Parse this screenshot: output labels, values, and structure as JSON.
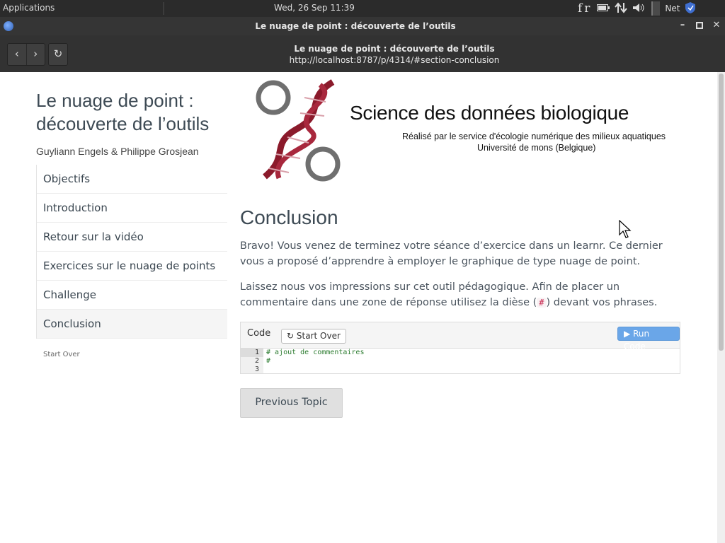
{
  "taskbar": {
    "applications": "Applications",
    "clock": "Wed, 26 Sep  11:39",
    "keyboard_layout": "fr",
    "network_label": "Net"
  },
  "window": {
    "title": "Le nuage de point : découverte de l’outils",
    "buttons": [
      "minimize-icon",
      "maximize-icon",
      "close-icon"
    ]
  },
  "browser": {
    "page_title": "Le nuage de point : découverte de l’outils",
    "url": "http://localhost:8787/p/4314/#section-conclusion"
  },
  "sidebar": {
    "title": "Le nuage de point : découverte de l’outils",
    "authors": "Guyliann Engels & Philippe Grosjean",
    "items": [
      {
        "label": "Objectifs"
      },
      {
        "label": "Introduction"
      },
      {
        "label": "Retour sur la vidéo"
      },
      {
        "label": "Exercices sur le nuage de points"
      },
      {
        "label": "Challenge"
      },
      {
        "label": "Conclusion",
        "active": true
      }
    ],
    "start_over": "Start Over"
  },
  "banner": {
    "heading": "Science des données biologique",
    "line1": "Réalisé par le service d'écologie numérique des milieux aquatiques",
    "line2": "Université de mons (Belgique)"
  },
  "main": {
    "section_title": "Conclusion",
    "paragraph1": "Bravo! Vous venez de terminez votre séance d’exercice dans un learnr. Ce dernier vous a proposé d’apprendre à employer le graphique de type nuage de point.",
    "paragraph2_before": "Laissez nous vos impressions sur cet outil pédagogique. Afin de placer un commentaire dans une zone de réponse utilisez la dièse (",
    "paragraph2_code": "#",
    "paragraph2_after": ") devant vos phrases.",
    "exercise": {
      "label": "Code",
      "start_over": "Start Over",
      "run_code": "Run Code",
      "lines": [
        {
          "n": "1",
          "text": "# ajout de commentaires"
        },
        {
          "n": "2",
          "text": "#"
        },
        {
          "n": "3",
          "text": ""
        }
      ]
    },
    "previous_topic": "Previous Topic"
  },
  "colors": {
    "logo_helix": "#8b1a2b",
    "logo_rings": "#6f6f6f",
    "run_button": "#6aa6e8",
    "title_text": "#3d4a54"
  }
}
